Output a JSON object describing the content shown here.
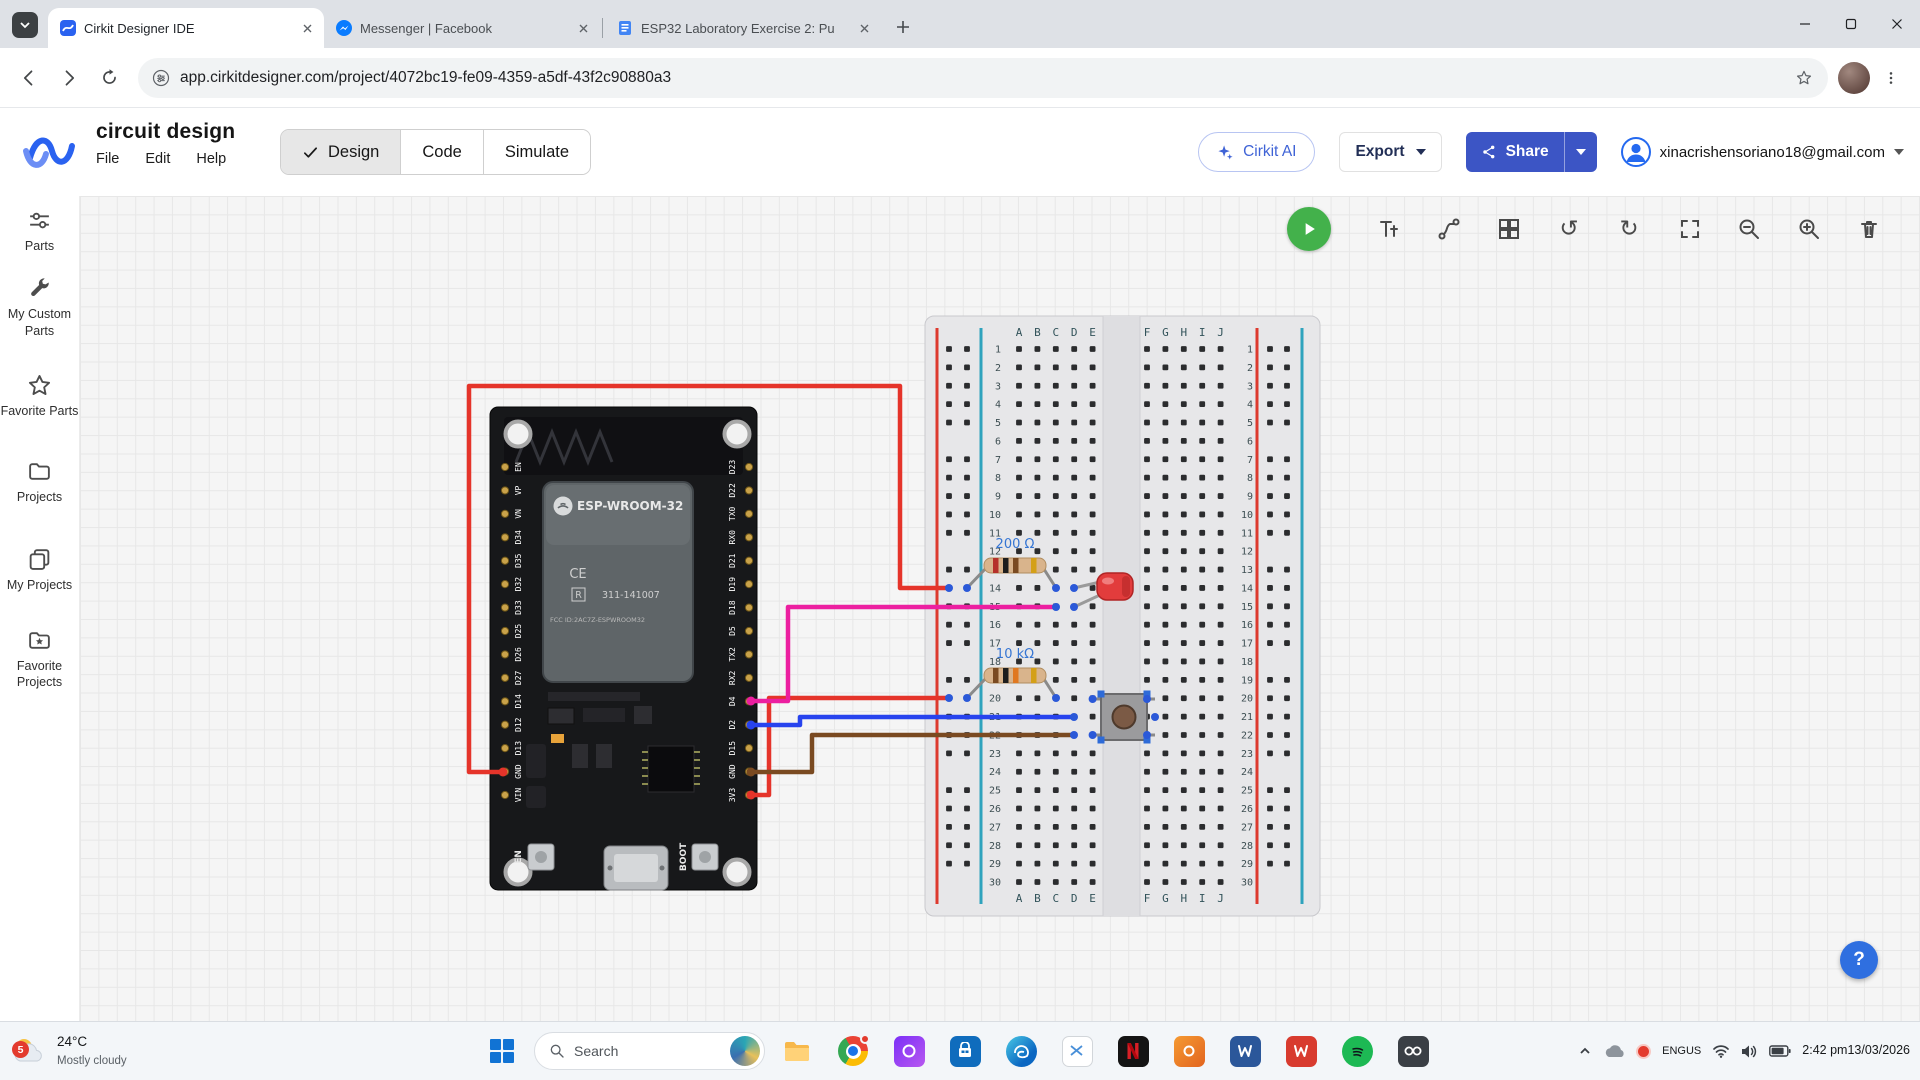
{
  "browser": {
    "tabs": [
      {
        "title": "Cirkit Designer IDE"
      },
      {
        "title": "Messenger | Facebook"
      },
      {
        "title": "ESP32 Laboratory Exercise 2: Pu"
      }
    ],
    "url": "app.cirkitdesigner.com/project/4072bc19-fe09-4359-a5df-43f2c90880a3"
  },
  "header": {
    "app_title": "circuit design",
    "menu": {
      "file": "File",
      "edit": "Edit",
      "help": "Help"
    },
    "mode_tabs": {
      "design": "Design",
      "code": "Code",
      "simulate": "Simulate"
    },
    "cirkit_ai_label": "Cirkit AI",
    "export_label": "Export",
    "share_label": "Share",
    "account_email": "xinacrishensoriano18@gmail.com"
  },
  "sidebar": {
    "items": [
      {
        "label": "Parts"
      },
      {
        "label": "My Custom Parts"
      },
      {
        "label": "Favorite Parts"
      },
      {
        "label": "Projects"
      },
      {
        "label": "My Projects"
      },
      {
        "label": "Favorite Projects"
      }
    ]
  },
  "circuit": {
    "esp32": {
      "module_label": "ESP-WROOM-32",
      "ce_mark": "CE",
      "r_mark": "R",
      "serial": "311-141007",
      "fcc_line": "FCC ID:2AC7Z-ESPWROOM32",
      "en_button": "EN",
      "boot_button": "BOOT",
      "left_pins_top_to_bottom": [
        "EN",
        "VP",
        "VN",
        "D34",
        "D35",
        "D32",
        "D33",
        "D25",
        "D26",
        "D27",
        "D14",
        "D12",
        "D13",
        "GND",
        "VIN"
      ],
      "right_pins_top_to_bottom": [
        "D23",
        "D22",
        "TX0",
        "RX0",
        "D21",
        "D19",
        "D18",
        "D5",
        "TX2",
        "RX2",
        "D4",
        "D2",
        "D15",
        "GND",
        "3V3"
      ]
    },
    "breadboard": {
      "left_columns": [
        "A",
        "B",
        "C",
        "D",
        "E"
      ],
      "right_columns": [
        "F",
        "G",
        "H",
        "I",
        "J"
      ],
      "row_count": 30
    },
    "components": [
      {
        "type": "resistor",
        "label": "200 Ω"
      },
      {
        "type": "resistor",
        "label": "10 kΩ"
      },
      {
        "type": "led",
        "color": "red"
      },
      {
        "type": "pushbutton"
      }
    ],
    "wire_colors": {
      "power": "#e5342a",
      "signal_led": "#ec1fa0",
      "signal_button": "#2743ee",
      "ground": "#7a4a21"
    }
  },
  "canvas": {
    "help_label": "?"
  },
  "taskbar": {
    "weather": {
      "badge": "5",
      "temp": "24°C",
      "condition": "Mostly cloudy"
    },
    "search_placeholder": "Search",
    "tray": {
      "lang": "ENG",
      "region": "US",
      "time": "2:42 pm",
      "date": "13/03/2026"
    }
  }
}
